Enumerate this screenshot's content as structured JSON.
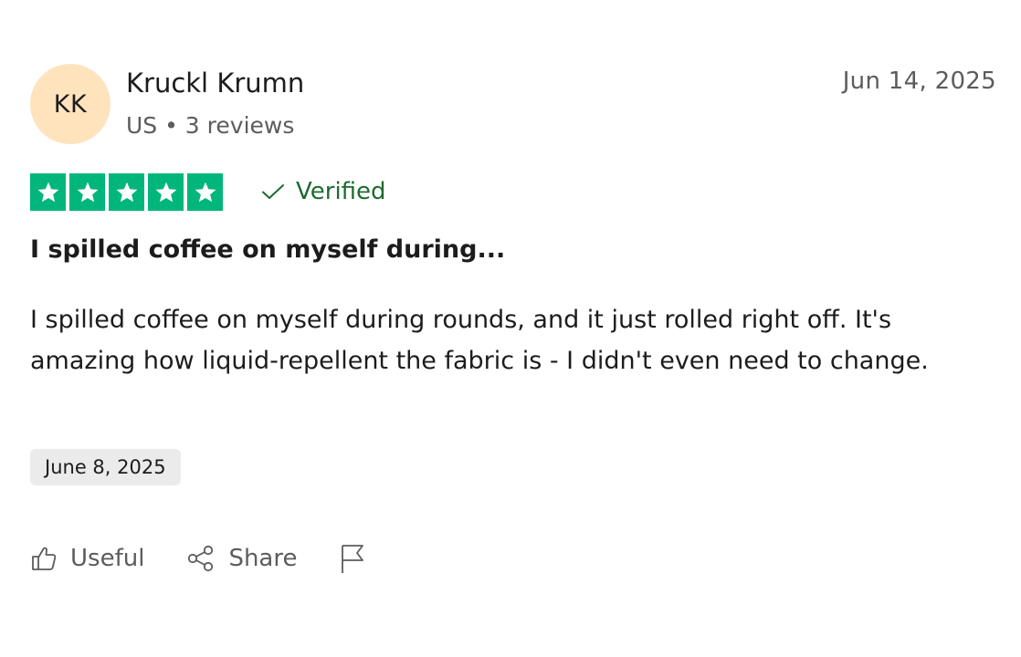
{
  "reviewer": {
    "initials": "KK",
    "name": "Kruckl Krumn",
    "meta": "US • 3 reviews"
  },
  "review": {
    "date": "Jun 14, 2025",
    "rating": 5,
    "verified_label": "Verified",
    "title": "I spilled coffee on myself during...",
    "body": "I spilled coffee on myself during rounds, and it just rolled right off. It's amazing how liquid-repellent the fabric is - I didn't even need to change.",
    "experience_date": "June 8, 2025"
  },
  "actions": {
    "useful_label": "Useful",
    "share_label": "Share"
  },
  "colors": {
    "star_green": "#00b67a",
    "verified_green": "#1e6b30",
    "avatar_bg": "#ffe3bd"
  },
  "icons": {
    "star": "star-icon",
    "verified": "check-icon",
    "useful": "thumbs-up-icon",
    "share": "share-icon",
    "report": "flag-icon"
  }
}
